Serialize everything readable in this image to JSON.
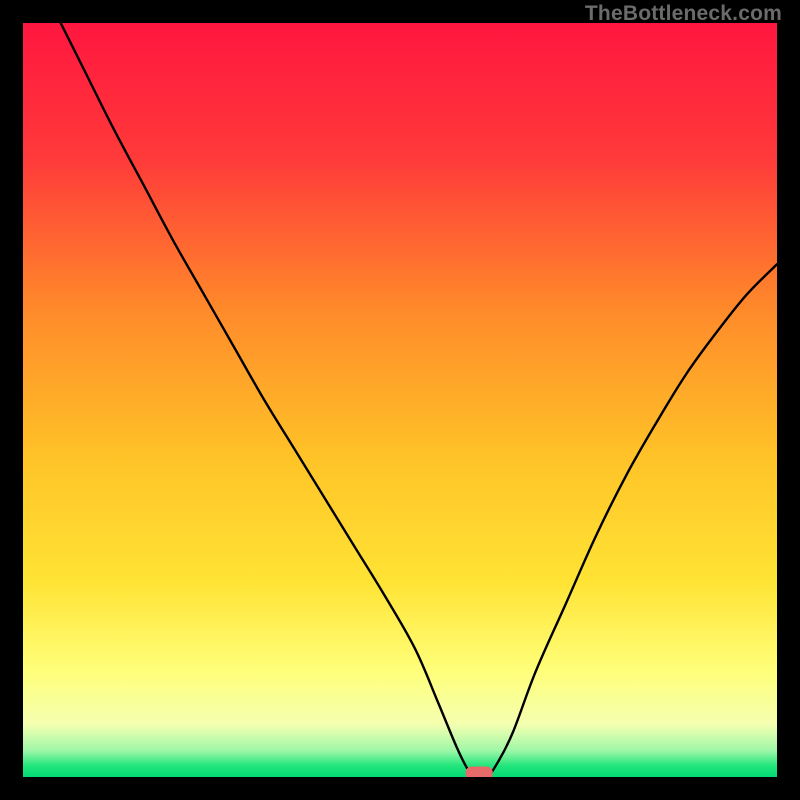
{
  "watermark": "TheBottleneck.com",
  "chart_data": {
    "type": "line",
    "title": "",
    "xlabel": "",
    "ylabel": "",
    "xlim": [
      0,
      100
    ],
    "ylim": [
      0,
      100
    ],
    "grid": false,
    "legend": false,
    "background": {
      "style": "vertical-gradient",
      "description": "red at top → orange → yellow → pale-yellow → thin green band at bottom",
      "stops": [
        {
          "pos": 0.0,
          "color": "#ff163f"
        },
        {
          "pos": 0.18,
          "color": "#ff3a3a"
        },
        {
          "pos": 0.38,
          "color": "#ff8a2a"
        },
        {
          "pos": 0.58,
          "color": "#ffc428"
        },
        {
          "pos": 0.74,
          "color": "#ffe334"
        },
        {
          "pos": 0.86,
          "color": "#ffff7a"
        },
        {
          "pos": 0.93,
          "color": "#f4ffb0"
        },
        {
          "pos": 0.965,
          "color": "#9ef7a8"
        },
        {
          "pos": 0.985,
          "color": "#22e67b"
        },
        {
          "pos": 1.0,
          "color": "#00d873"
        }
      ]
    },
    "series": [
      {
        "name": "bottleneck-curve",
        "color": "#000000",
        "stroke_width": 2.4,
        "x": [
          0,
          4,
          8,
          12,
          16,
          20,
          24,
          28,
          32,
          36,
          40,
          44,
          48,
          52,
          55,
          57.5,
          59,
          60,
          61.5,
          63,
          65,
          68,
          72,
          76,
          80,
          84,
          88,
          92,
          96,
          100
        ],
        "y": [
          110,
          102,
          94,
          86,
          78.5,
          71,
          64,
          57,
          50,
          43.5,
          37,
          30.5,
          24,
          17,
          10,
          4,
          1,
          0,
          0,
          2,
          6,
          14,
          23,
          32,
          40,
          47,
          53.5,
          59,
          64,
          68
        ]
      }
    ],
    "marker": {
      "name": "optimal-point",
      "shape": "rounded-rect",
      "color": "#e66a6a",
      "x": 60.5,
      "y": 0.5,
      "w": 3.6,
      "h": 1.8
    }
  }
}
